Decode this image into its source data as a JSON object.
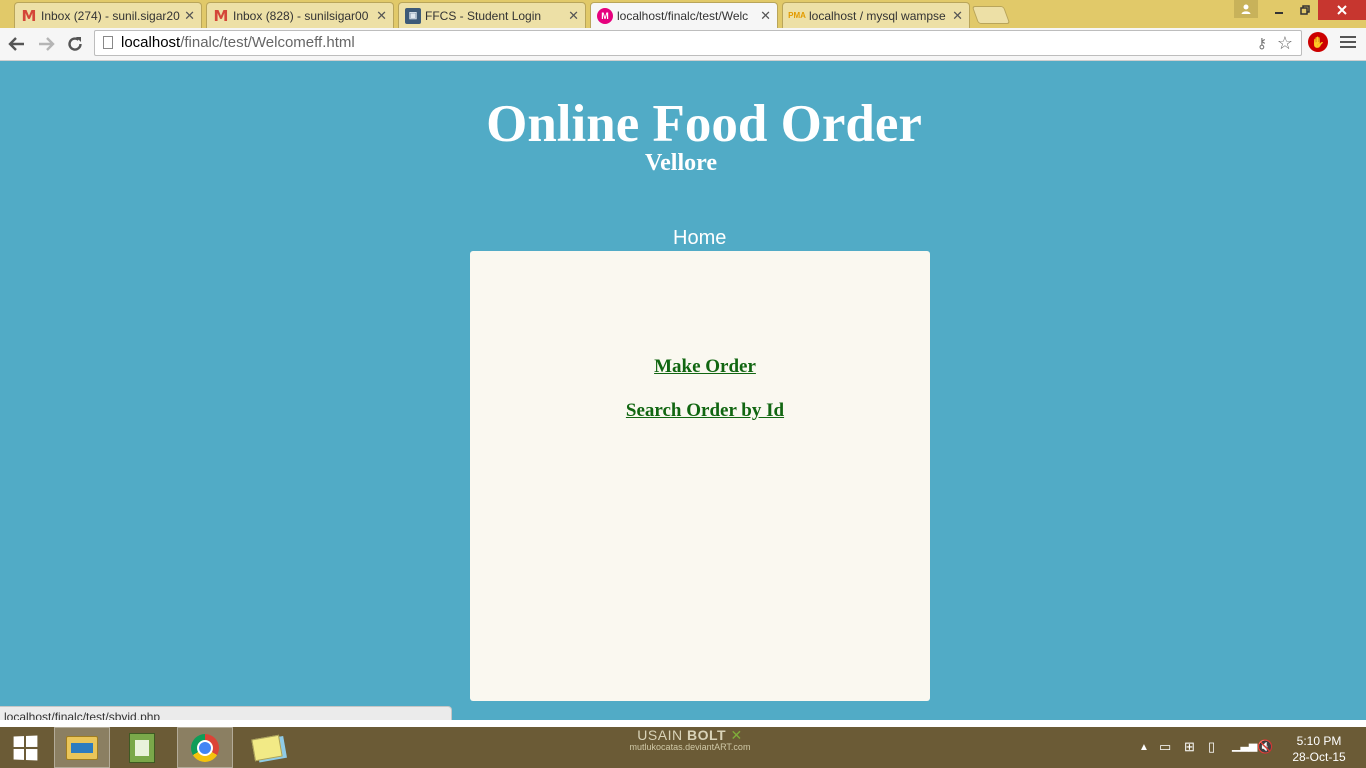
{
  "tabs": [
    {
      "title": "Inbox (274) - sunil.sigar20",
      "icon": "gmail-icon"
    },
    {
      "title": "Inbox (828) - sunilsigar00",
      "icon": "gmail-icon"
    },
    {
      "title": "FFCS - Student Login",
      "icon": "ffcs-icon"
    },
    {
      "title": "localhost/finalc/test/Welc",
      "icon": "localhost-icon"
    },
    {
      "title": "localhost / mysql wampse",
      "icon": "phpmyadmin-icon"
    }
  ],
  "address": {
    "host": "localhost",
    "path": "/finalc/test/Welcomeff.html"
  },
  "page": {
    "title": "Online Food Order",
    "subtitle": "Vellore",
    "nav_home": "Home",
    "links": {
      "make_order": "Make Order",
      "search_order": "Search Order by Id"
    }
  },
  "status_url": "localhost/finalc/test/sbyid.php",
  "taskbar": {
    "wallpaper_line1_a": "USAIN",
    "wallpaper_line1_b": "BOLT",
    "wallpaper_line2": "mutlukocatas.deviantART.com",
    "time": "5:10 PM",
    "date": "28-Oct-15"
  }
}
